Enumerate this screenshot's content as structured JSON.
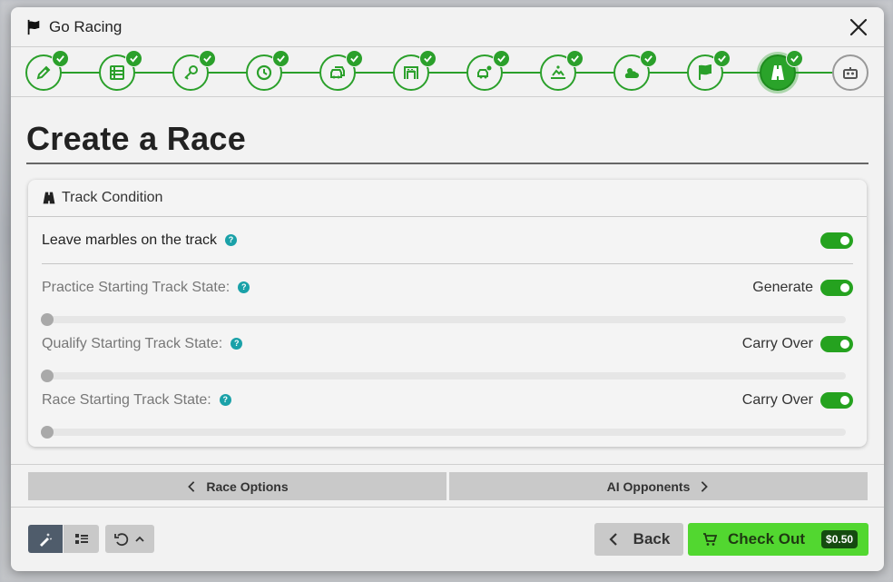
{
  "window": {
    "title": "Go Racing"
  },
  "steps": [
    {
      "icon": "pencil-icon",
      "status": "done"
    },
    {
      "icon": "list-icon",
      "status": "done"
    },
    {
      "icon": "key-icon",
      "status": "done"
    },
    {
      "icon": "clock-icon",
      "status": "done"
    },
    {
      "icon": "cars-icon",
      "status": "done"
    },
    {
      "icon": "garage-icon",
      "status": "done"
    },
    {
      "icon": "car-settings-icon",
      "status": "done"
    },
    {
      "icon": "landscape-icon",
      "status": "done"
    },
    {
      "icon": "weather-icon",
      "status": "done"
    },
    {
      "icon": "flag-icon",
      "status": "done"
    },
    {
      "icon": "road-icon",
      "status": "active"
    },
    {
      "icon": "robot-icon",
      "status": "pending"
    }
  ],
  "page": {
    "title": "Create a Race"
  },
  "card": {
    "header": "Track Condition",
    "marbles": {
      "label": "Leave marbles on the track",
      "enabled": true
    },
    "practice": {
      "label": "Practice Starting Track State:",
      "value": "Generate",
      "enabled": true,
      "slider": 0
    },
    "qualify": {
      "label": "Qualify Starting Track State:",
      "value": "Carry Over",
      "enabled": true,
      "slider": 0
    },
    "race": {
      "label": "Race Starting Track State:",
      "value": "Carry Over",
      "enabled": true,
      "slider": 0
    }
  },
  "nav": {
    "prev_label": "Race Options",
    "next_label": "AI Opponents"
  },
  "footer": {
    "back_label": "Back",
    "checkout_label": "Check Out",
    "price": "$0.50"
  },
  "colors": {
    "accent": "#2ba02b",
    "checkout": "#52d730",
    "help": "#1aa1a8"
  }
}
